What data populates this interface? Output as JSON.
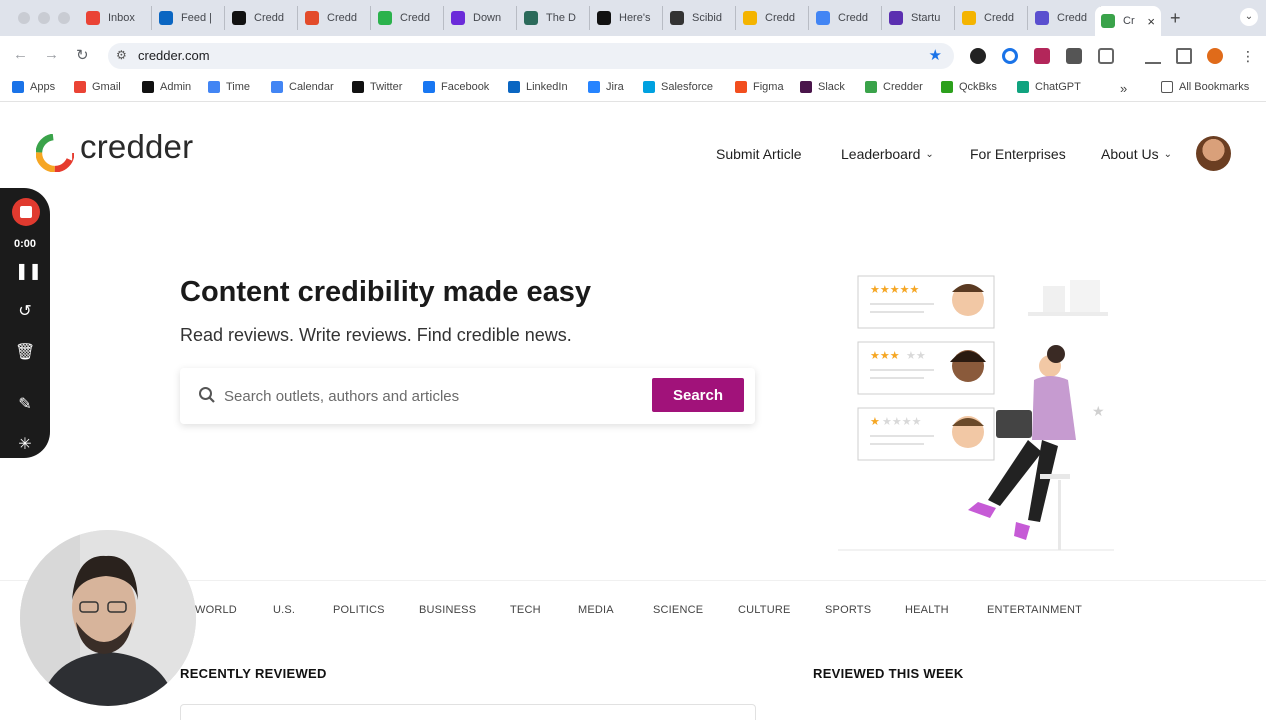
{
  "browser": {
    "tabs": [
      {
        "title": "",
        "icon": "traffic-lights"
      },
      {
        "title": "Inbox",
        "icon": "gmail-icon",
        "color": "#ea4335"
      },
      {
        "title": "Feed |",
        "icon": "linkedin-icon",
        "color": "#0a66c2"
      },
      {
        "title": "Credd",
        "icon": "triangle-icon",
        "color": "#111111"
      },
      {
        "title": "Credd",
        "icon": "credder-c-icon",
        "color": "#e34b2a"
      },
      {
        "title": "Credd",
        "icon": "w-icon",
        "color": "#2bb24c"
      },
      {
        "title": "Down",
        "icon": "circle-icon",
        "color": "#6b2bd9"
      },
      {
        "title": "The D",
        "icon": "image-icon",
        "color": "#2b6a5a"
      },
      {
        "title": "Here's",
        "icon": "d-icon",
        "color": "#111111"
      },
      {
        "title": "Scibid",
        "icon": "grid-icon",
        "color": "#333333"
      },
      {
        "title": "Credd",
        "icon": "slides-icon",
        "color": "#f4b400"
      },
      {
        "title": "Credd",
        "icon": "calendar-icon",
        "color": "#4285f4"
      },
      {
        "title": "Startu",
        "icon": "forms-icon",
        "color": "#5b2fb0"
      },
      {
        "title": "Credd",
        "icon": "slides-icon",
        "color": "#f4b400"
      },
      {
        "title": "Credd",
        "icon": "gear-icon",
        "color": "#5a4fcf"
      },
      {
        "title": "Cr",
        "icon": "credder-c-icon",
        "color": "#3aa34a",
        "active": true
      }
    ],
    "url": "credder.com",
    "bookmarks": [
      {
        "label": "Apps",
        "icon": "apps-grid-icon",
        "color": "#1a73e8"
      },
      {
        "label": "Gmail",
        "icon": "gmail-icon",
        "color": "#ea4335"
      },
      {
        "label": "Admin",
        "icon": "triangle-icon",
        "color": "#111111"
      },
      {
        "label": "Time",
        "icon": "calendar-blue-icon",
        "color": "#4285f4"
      },
      {
        "label": "Calendar",
        "icon": "calendar-icon",
        "color": "#4285f4"
      },
      {
        "label": "Twitter",
        "icon": "x-icon",
        "color": "#111111"
      },
      {
        "label": "Facebook",
        "icon": "facebook-icon",
        "color": "#1877f2"
      },
      {
        "label": "LinkedIn",
        "icon": "linkedin-icon",
        "color": "#0a66c2"
      },
      {
        "label": "Jira",
        "icon": "jira-icon",
        "color": "#2684ff"
      },
      {
        "label": "Salesforce",
        "icon": "salesforce-icon",
        "color": "#00a1e0"
      },
      {
        "label": "Figma",
        "icon": "figma-icon",
        "color": "#f24e1e"
      },
      {
        "label": "Slack",
        "icon": "slack-icon",
        "color": "#4a154b"
      },
      {
        "label": "Credder",
        "icon": "credder-c-icon",
        "color": "#3aa34a"
      },
      {
        "label": "QckBks",
        "icon": "quickbooks-icon",
        "color": "#2ca01c"
      },
      {
        "label": "ChatGPT",
        "icon": "chatgpt-icon",
        "color": "#10a37f"
      }
    ],
    "all_bookmarks": "All Bookmarks",
    "more_bookmarks": "»"
  },
  "site": {
    "logo": "credder",
    "nav": {
      "submit": "Submit Article",
      "leaderboard": "Leaderboard",
      "enterprises": "For Enterprises",
      "about": "About Us"
    },
    "hero": {
      "title": "Content credibility made easy",
      "subtitle": "Read reviews. Write reviews. Find credible news."
    },
    "search": {
      "placeholder": "Search outlets, authors and articles",
      "button": "Search"
    },
    "categories": [
      "WORLD",
      "U.S.",
      "POLITICS",
      "BUSINESS",
      "TECH",
      "MEDIA",
      "SCIENCE",
      "CULTURE",
      "SPORTS",
      "HEALTH",
      "ENTERTAINMENT"
    ],
    "sections": {
      "recent": "RECENTLY REVIEWED",
      "week": "REVIEWED THIS WEEK"
    },
    "accent": "#a1127a",
    "illustration_ratings": [
      5,
      3,
      1
    ]
  },
  "recorder": {
    "time": "0:00"
  }
}
